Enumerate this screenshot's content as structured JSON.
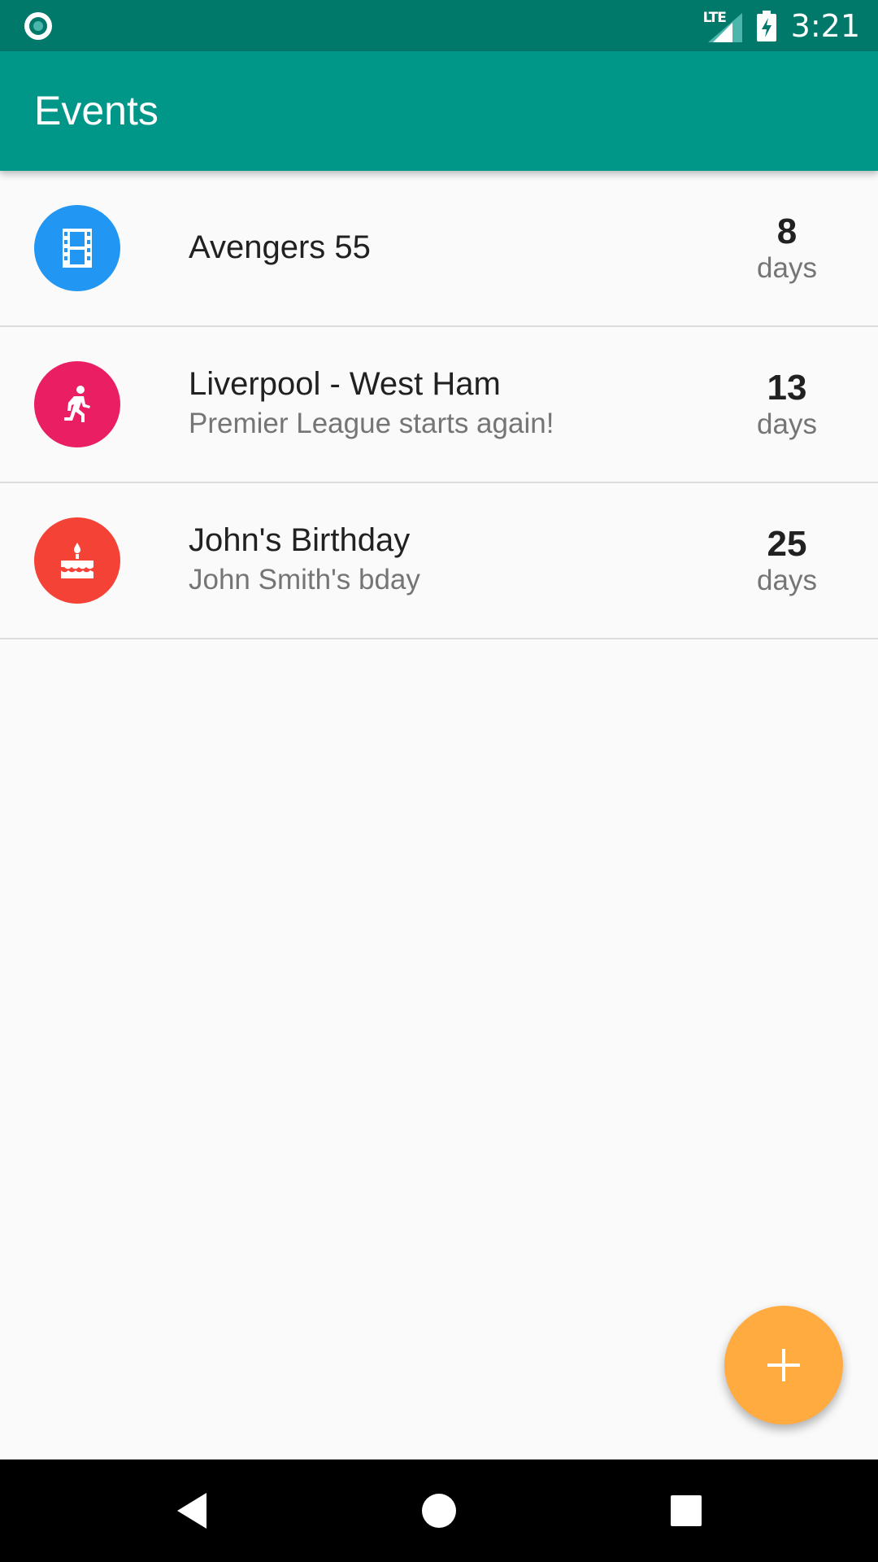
{
  "status_bar": {
    "network": "LTE",
    "time": "3:21"
  },
  "app_bar": {
    "title": "Events"
  },
  "events": [
    {
      "title": "Avengers 55",
      "subtitle": "",
      "count": "8",
      "unit": "days",
      "icon": "movie-film-icon",
      "color": "#2196f3"
    },
    {
      "title": "Liverpool - West Ham",
      "subtitle": "Premier League starts again!",
      "count": "13",
      "unit": "days",
      "icon": "running-person-icon",
      "color": "#e91e63"
    },
    {
      "title": "John's Birthday",
      "subtitle": "John Smith's bday",
      "count": "25",
      "unit": "days",
      "icon": "birthday-cake-icon",
      "color": "#f44336"
    }
  ],
  "fab": {
    "icon": "plus-icon",
    "color": "#ffab40"
  },
  "nav_bar": {
    "back_icon": "back-triangle-icon",
    "home_icon": "home-circle-icon",
    "recents_icon": "recents-square-icon"
  },
  "colors": {
    "status_bar": "#00796b",
    "app_bar": "#009688",
    "background": "#fafafa"
  }
}
